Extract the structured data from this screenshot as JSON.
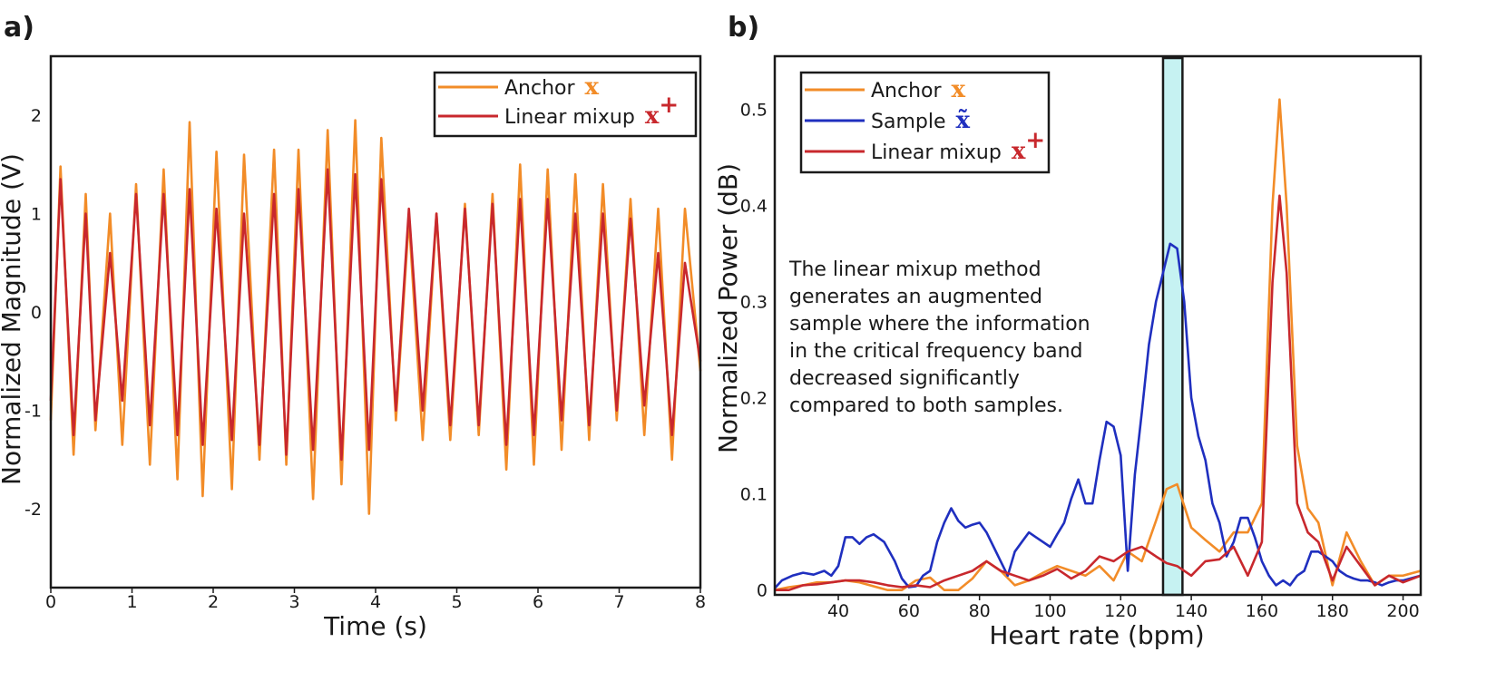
{
  "chart_data": [
    {
      "panel": "a)",
      "type": "line",
      "xlabel": "Time (s)",
      "ylabel": "Normalized Magnitude (V)",
      "xlim": [
        0,
        8
      ],
      "ylim": [
        -2.8,
        2.6
      ],
      "xticks": [
        "0",
        "1",
        "2",
        "3",
        "4",
        "5",
        "6",
        "7",
        "8"
      ],
      "yticks": [
        "2",
        "1",
        "0",
        "-1",
        "-2"
      ],
      "grid": false,
      "legend_position": "top-right",
      "series": [
        {
          "name": "Anchor",
          "symbol": "x",
          "color": "#f28c28",
          "x": [
            0,
            0.12,
            0.28,
            0.43,
            0.55,
            0.73,
            0.88,
            1.05,
            1.22,
            1.39,
            1.56,
            1.71,
            1.87,
            2.04,
            2.23,
            2.38,
            2.57,
            2.75,
            2.9,
            3.05,
            3.23,
            3.41,
            3.58,
            3.75,
            3.92,
            4.07,
            4.25,
            4.41,
            4.58,
            4.75,
            4.92,
            5.1,
            5.27,
            5.44,
            5.61,
            5.78,
            5.95,
            6.12,
            6.29,
            6.46,
            6.63,
            6.8,
            6.97,
            7.14,
            7.31,
            7.48,
            7.65,
            7.81,
            8.0
          ],
          "values": [
            -1.1,
            1.48,
            -1.45,
            1.2,
            -1.2,
            1.0,
            -1.35,
            1.3,
            -1.55,
            1.45,
            -1.7,
            1.93,
            -1.87,
            1.63,
            -1.8,
            1.6,
            -1.5,
            1.65,
            -1.55,
            1.65,
            -1.9,
            1.85,
            -1.75,
            1.95,
            -2.05,
            1.77,
            -1.1,
            0.95,
            -1.3,
            1.0,
            -1.3,
            1.1,
            -1.25,
            1.2,
            -1.6,
            1.5,
            -1.55,
            1.45,
            -1.4,
            1.4,
            -1.3,
            1.3,
            -1.1,
            1.15,
            -1.25,
            1.05,
            -1.5,
            1.05,
            -0.6
          ]
        },
        {
          "name": "Linear mixup",
          "symbol": "x+",
          "color": "#c8282d",
          "x": [
            0,
            0.12,
            0.28,
            0.43,
            0.55,
            0.73,
            0.88,
            1.05,
            1.22,
            1.39,
            1.56,
            1.71,
            1.87,
            2.04,
            2.23,
            2.38,
            2.57,
            2.75,
            2.9,
            3.05,
            3.23,
            3.41,
            3.58,
            3.75,
            3.92,
            4.07,
            4.25,
            4.41,
            4.58,
            4.75,
            4.92,
            5.1,
            5.27,
            5.44,
            5.61,
            5.78,
            5.95,
            6.12,
            6.29,
            6.46,
            6.63,
            6.8,
            6.97,
            7.14,
            7.31,
            7.48,
            7.65,
            7.81,
            8.0
          ],
          "values": [
            -0.9,
            1.35,
            -1.25,
            1.0,
            -1.1,
            0.6,
            -0.9,
            1.2,
            -1.15,
            1.2,
            -1.25,
            1.25,
            -1.35,
            1.05,
            -1.3,
            1.0,
            -1.35,
            1.2,
            -1.45,
            1.25,
            -1.4,
            1.45,
            -1.5,
            1.4,
            -1.4,
            1.35,
            -1.0,
            1.05,
            -1.0,
            1.0,
            -1.15,
            1.05,
            -1.15,
            1.1,
            -1.35,
            1.15,
            -1.25,
            1.15,
            -1.1,
            1.0,
            -1.15,
            1.0,
            -1.0,
            0.95,
            -0.95,
            0.6,
            -1.25,
            0.5,
            -0.5
          ]
        }
      ]
    },
    {
      "panel": "b)",
      "type": "line",
      "xlabel": "Heart rate (bpm)",
      "ylabel": "Normalized Power (dB)",
      "xlim": [
        22,
        205
      ],
      "ylim": [
        -0.005,
        0.555
      ],
      "xticks": [
        "40",
        "60",
        "80",
        "100",
        "120",
        "140",
        "160",
        "180",
        "200"
      ],
      "yticks": [
        "0.5",
        "0.4",
        "0.3",
        "0.2",
        "0.1",
        "0"
      ],
      "grid": false,
      "legend_position": "top-left",
      "highlight_band_bpm": [
        132,
        137.5
      ],
      "highlight_color": "#c6f2f2",
      "annotation": [
        "The linear mixup method",
        "generates an augmented",
        "sample where the information",
        "in the critical frequency band",
        "decreased significantly",
        "compared to both samples."
      ],
      "series": [
        {
          "name": "Anchor",
          "symbol": "x",
          "color": "#f28c28",
          "x": [
            22,
            26,
            30,
            34,
            38,
            42,
            46,
            50,
            54,
            58,
            62,
            66,
            70,
            74,
            78,
            82,
            86,
            90,
            94,
            98,
            102,
            106,
            110,
            114,
            118,
            122,
            126,
            130,
            133,
            136,
            140,
            144,
            148,
            152,
            156,
            160,
            163,
            165,
            167,
            170,
            173,
            176,
            180,
            184,
            188,
            192,
            196,
            200,
            205
          ],
          "values": [
            0.0,
            0.003,
            0.005,
            0.008,
            0.008,
            0.01,
            0.008,
            0.004,
            0.0,
            0.0,
            0.01,
            0.013,
            0.0,
            0.0,
            0.012,
            0.03,
            0.02,
            0.005,
            0.01,
            0.018,
            0.025,
            0.02,
            0.015,
            0.025,
            0.01,
            0.04,
            0.03,
            0.072,
            0.105,
            0.11,
            0.065,
            0.052,
            0.04,
            0.06,
            0.06,
            0.09,
            0.4,
            0.51,
            0.4,
            0.15,
            0.085,
            0.07,
            0.005,
            0.06,
            0.03,
            0.005,
            0.015,
            0.015,
            0.02
          ]
        },
        {
          "name": "Sample",
          "symbol": "x~",
          "color": "#1f2fbf",
          "x": [
            22,
            24,
            27,
            30,
            33,
            36,
            38,
            40,
            42,
            44,
            46,
            48,
            50,
            53,
            56,
            58,
            60,
            62,
            64,
            66,
            68,
            70,
            72,
            74,
            76,
            78,
            80,
            82,
            84,
            86,
            88,
            90,
            92,
            94,
            96,
            98,
            100,
            102,
            104,
            106,
            108,
            110,
            112,
            114,
            116,
            118,
            120,
            122,
            124,
            126,
            128,
            130,
            132,
            134,
            136,
            138,
            140,
            142,
            144,
            146,
            148,
            150,
            152,
            154,
            156,
            158,
            160,
            162,
            164,
            166,
            168,
            170,
            172,
            174,
            176,
            178,
            180,
            182,
            184,
            186,
            188,
            190,
            192,
            194,
            196,
            198,
            200,
            202,
            205
          ],
          "values": [
            0.002,
            0.01,
            0.015,
            0.018,
            0.016,
            0.02,
            0.015,
            0.025,
            0.055,
            0.055,
            0.048,
            0.055,
            0.058,
            0.05,
            0.03,
            0.012,
            0.003,
            0.004,
            0.015,
            0.02,
            0.05,
            0.07,
            0.085,
            0.072,
            0.065,
            0.068,
            0.07,
            0.06,
            0.045,
            0.03,
            0.015,
            0.04,
            0.05,
            0.06,
            0.055,
            0.05,
            0.045,
            0.058,
            0.07,
            0.095,
            0.115,
            0.09,
            0.09,
            0.135,
            0.175,
            0.17,
            0.14,
            0.02,
            0.12,
            0.185,
            0.255,
            0.3,
            0.33,
            0.36,
            0.355,
            0.3,
            0.2,
            0.16,
            0.135,
            0.09,
            0.07,
            0.035,
            0.05,
            0.075,
            0.075,
            0.055,
            0.03,
            0.015,
            0.005,
            0.01,
            0.005,
            0.015,
            0.02,
            0.04,
            0.04,
            0.035,
            0.03,
            0.02,
            0.015,
            0.012,
            0.01,
            0.01,
            0.008,
            0.005,
            0.008,
            0.01,
            0.01,
            0.012,
            0.015
          ]
        },
        {
          "name": "Linear mixup",
          "symbol": "x+",
          "color": "#c8282d",
          "x": [
            22,
            26,
            30,
            34,
            38,
            42,
            46,
            50,
            54,
            58,
            62,
            66,
            70,
            74,
            78,
            82,
            86,
            90,
            94,
            98,
            102,
            106,
            110,
            114,
            118,
            122,
            126,
            130,
            133,
            136,
            140,
            144,
            148,
            152,
            156,
            160,
            163,
            165,
            167,
            170,
            173,
            176,
            180,
            184,
            188,
            192,
            196,
            200,
            205
          ],
          "values": [
            0.0,
            0.0,
            0.005,
            0.006,
            0.008,
            0.01,
            0.01,
            0.008,
            0.005,
            0.003,
            0.005,
            0.003,
            0.01,
            0.015,
            0.02,
            0.03,
            0.02,
            0.015,
            0.01,
            0.015,
            0.022,
            0.012,
            0.02,
            0.035,
            0.03,
            0.04,
            0.045,
            0.035,
            0.028,
            0.025,
            0.015,
            0.03,
            0.032,
            0.045,
            0.015,
            0.05,
            0.32,
            0.41,
            0.33,
            0.09,
            0.06,
            0.05,
            0.01,
            0.045,
            0.025,
            0.005,
            0.015,
            0.008,
            0.015
          ]
        }
      ]
    }
  ],
  "legend_a": [
    {
      "label": "Anchor",
      "symbol": "x",
      "sup": "",
      "color": "#f28c28"
    },
    {
      "label": "Linear mixup",
      "symbol": "x",
      "sup": "+",
      "color": "#c8282d"
    }
  ],
  "legend_b": [
    {
      "label": "Anchor",
      "symbol": "x",
      "sup": "",
      "color": "#f28c28"
    },
    {
      "label": "Sample",
      "symbol": "x̃",
      "sup": "",
      "color": "#1f2fbf"
    },
    {
      "label": "Linear mixup",
      "symbol": "x",
      "sup": "+",
      "color": "#c8282d"
    }
  ]
}
